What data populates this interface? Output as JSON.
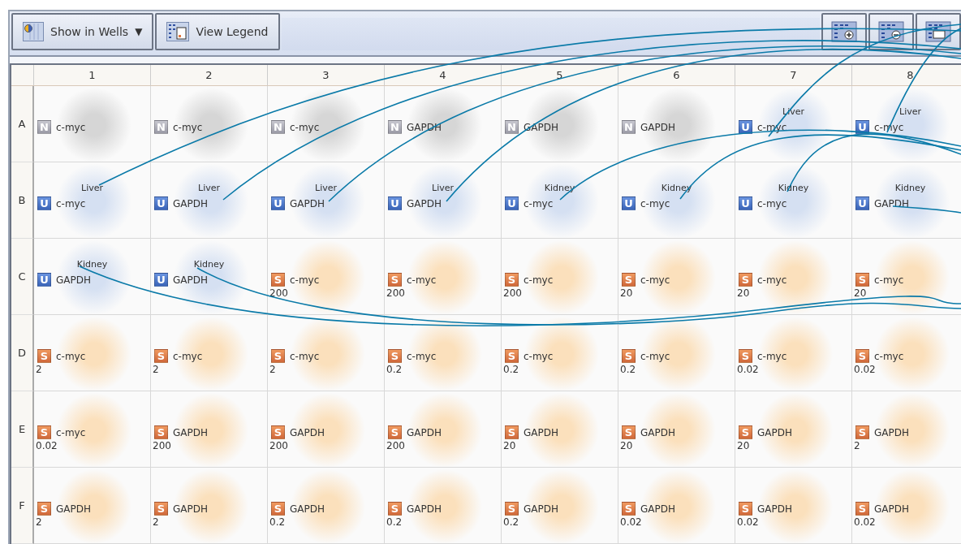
{
  "toolbar": {
    "buttons": [
      {
        "kind": "dropdown",
        "label": "Show in Wells",
        "caret": "▼"
      },
      {
        "kind": "legend",
        "label": "View Legend"
      }
    ],
    "icon_buttons": [
      {
        "kind": "zoom-in"
      },
      {
        "kind": "zoom-out"
      },
      {
        "kind": "fit"
      }
    ]
  },
  "plate": {
    "columns": [
      "1",
      "2",
      "3",
      "4",
      "5",
      "6",
      "7",
      "8"
    ],
    "rows": [
      {
        "label": "A",
        "wells": [
          {
            "kind": "ntc",
            "badge": "N",
            "target": "c-myc"
          },
          {
            "kind": "ntc",
            "badge": "N",
            "target": "c-myc"
          },
          {
            "kind": "ntc",
            "badge": "N",
            "target": "c-myc"
          },
          {
            "kind": "ntc",
            "badge": "N",
            "target": "GAPDH"
          },
          {
            "kind": "ntc",
            "badge": "N",
            "target": "GAPDH"
          },
          {
            "kind": "ntc",
            "badge": "N",
            "target": "GAPDH"
          },
          {
            "kind": "unknown",
            "badge": "U",
            "sample": "Liver",
            "target": "c-myc"
          },
          {
            "kind": "unknown",
            "badge": "U",
            "sample": "Liver",
            "target": "c-myc"
          }
        ]
      },
      {
        "label": "B",
        "wells": [
          {
            "kind": "unknown",
            "badge": "U",
            "sample": "Liver",
            "target": "c-myc"
          },
          {
            "kind": "unknown",
            "badge": "U",
            "sample": "Liver",
            "target": "GAPDH"
          },
          {
            "kind": "unknown",
            "badge": "U",
            "sample": "Liver",
            "target": "GAPDH"
          },
          {
            "kind": "unknown",
            "badge": "U",
            "sample": "Liver",
            "target": "GAPDH"
          },
          {
            "kind": "unknown",
            "badge": "U",
            "sample": "Kidney",
            "target": "c-myc"
          },
          {
            "kind": "unknown",
            "badge": "U",
            "sample": "Kidney",
            "target": "c-myc"
          },
          {
            "kind": "unknown",
            "badge": "U",
            "sample": "Kidney",
            "target": "c-myc"
          },
          {
            "kind": "unknown",
            "badge": "U",
            "sample": "Kidney",
            "target": "GAPDH"
          }
        ]
      },
      {
        "label": "C",
        "wells": [
          {
            "kind": "unknown",
            "badge": "U",
            "sample": "Kidney",
            "target": "GAPDH"
          },
          {
            "kind": "unknown",
            "badge": "U",
            "sample": "Kidney",
            "target": "GAPDH"
          },
          {
            "kind": "standard",
            "badge": "S",
            "target": "c-myc",
            "quantity": "200"
          },
          {
            "kind": "standard",
            "badge": "S",
            "target": "c-myc",
            "quantity": "200"
          },
          {
            "kind": "standard",
            "badge": "S",
            "target": "c-myc",
            "quantity": "200"
          },
          {
            "kind": "standard",
            "badge": "S",
            "target": "c-myc",
            "quantity": "20"
          },
          {
            "kind": "standard",
            "badge": "S",
            "target": "c-myc",
            "quantity": "20"
          },
          {
            "kind": "standard",
            "badge": "S",
            "target": "c-myc",
            "quantity": "20"
          }
        ]
      },
      {
        "label": "D",
        "wells": [
          {
            "kind": "standard",
            "badge": "S",
            "target": "c-myc",
            "quantity": "2"
          },
          {
            "kind": "standard",
            "badge": "S",
            "target": "c-myc",
            "quantity": "2"
          },
          {
            "kind": "standard",
            "badge": "S",
            "target": "c-myc",
            "quantity": "2"
          },
          {
            "kind": "standard",
            "badge": "S",
            "target": "c-myc",
            "quantity": "0.2"
          },
          {
            "kind": "standard",
            "badge": "S",
            "target": "c-myc",
            "quantity": "0.2"
          },
          {
            "kind": "standard",
            "badge": "S",
            "target": "c-myc",
            "quantity": "0.2"
          },
          {
            "kind": "standard",
            "badge": "S",
            "target": "c-myc",
            "quantity": "0.02"
          },
          {
            "kind": "standard",
            "badge": "S",
            "target": "c-myc",
            "quantity": "0.02"
          }
        ]
      },
      {
        "label": "E",
        "wells": [
          {
            "kind": "standard",
            "badge": "S",
            "target": "c-myc",
            "quantity": "0.02"
          },
          {
            "kind": "standard",
            "badge": "S",
            "target": "GAPDH",
            "quantity": "200"
          },
          {
            "kind": "standard",
            "badge": "S",
            "target": "GAPDH",
            "quantity": "200"
          },
          {
            "kind": "standard",
            "badge": "S",
            "target": "GAPDH",
            "quantity": "200"
          },
          {
            "kind": "standard",
            "badge": "S",
            "target": "GAPDH",
            "quantity": "20"
          },
          {
            "kind": "standard",
            "badge": "S",
            "target": "GAPDH",
            "quantity": "20"
          },
          {
            "kind": "standard",
            "badge": "S",
            "target": "GAPDH",
            "quantity": "20"
          },
          {
            "kind": "standard",
            "badge": "S",
            "target": "GAPDH",
            "quantity": "2"
          }
        ]
      },
      {
        "label": "F",
        "wells": [
          {
            "kind": "standard",
            "badge": "S",
            "target": "GAPDH",
            "quantity": "2"
          },
          {
            "kind": "standard",
            "badge": "S",
            "target": "GAPDH",
            "quantity": "2"
          },
          {
            "kind": "standard",
            "badge": "S",
            "target": "GAPDH",
            "quantity": "0.2"
          },
          {
            "kind": "standard",
            "badge": "S",
            "target": "GAPDH",
            "quantity": "0.2"
          },
          {
            "kind": "standard",
            "badge": "S",
            "target": "GAPDH",
            "quantity": "0.2"
          },
          {
            "kind": "standard",
            "badge": "S",
            "target": "GAPDH",
            "quantity": "0.02"
          },
          {
            "kind": "standard",
            "badge": "S",
            "target": "GAPDH",
            "quantity": "0.02"
          },
          {
            "kind": "standard",
            "badge": "S",
            "target": "GAPDH",
            "quantity": "0.02"
          }
        ]
      }
    ]
  }
}
